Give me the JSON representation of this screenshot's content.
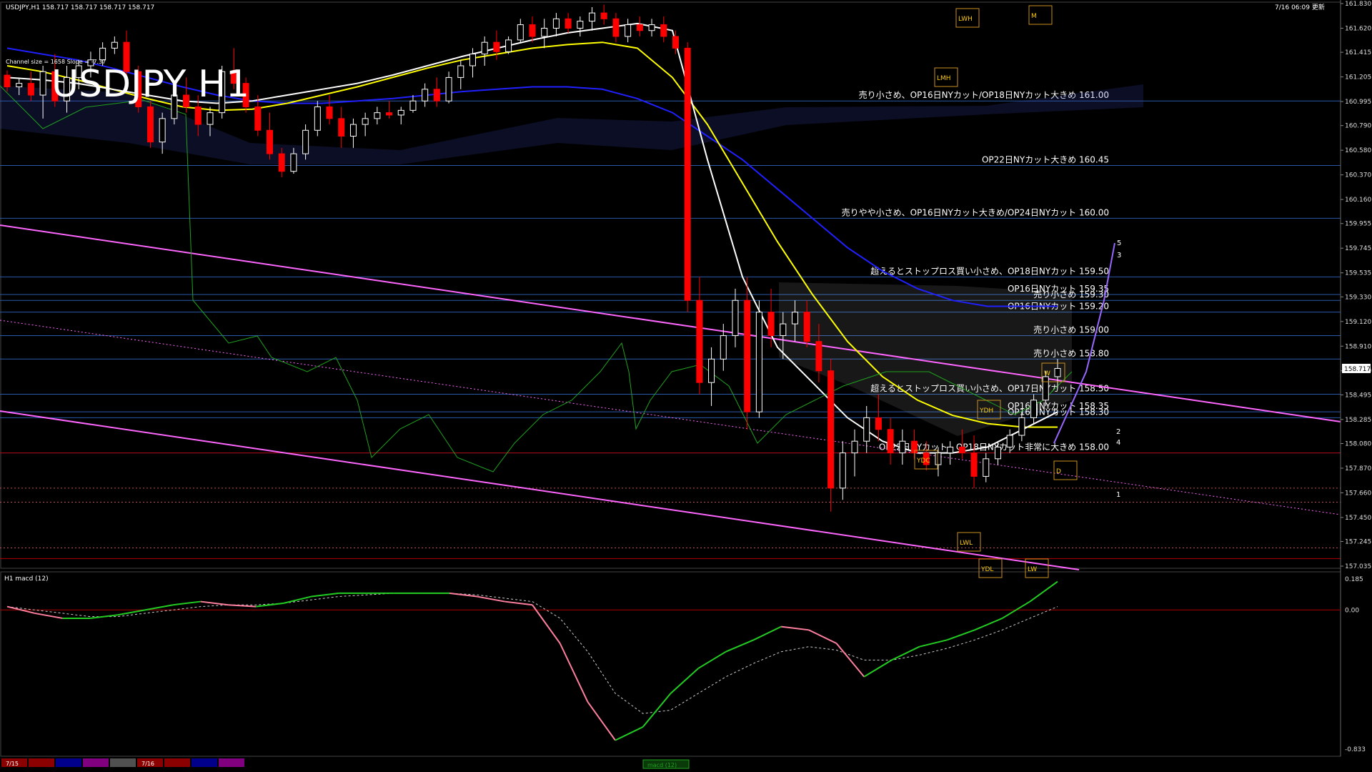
{
  "window": {
    "header": "USDJPY,H1  158.717 158.717 158.717 158.717",
    "timestamp": "7/16 06:09 更新",
    "big_title": "USDJPY H1",
    "channel_info": "Channel size = 1658 Slope = -7.37"
  },
  "colors": {
    "background": "#000000",
    "bull_candle": "#ffffff",
    "bear_candle": "#ff0000",
    "sma_fast": "#ffffff",
    "sma_mid": "#ffff00",
    "sma_slow": "#2020ff",
    "channel": "#ff66ff",
    "hline": "#2a5aa8",
    "macd_up": "#22cc22",
    "macd_down": "#ff7f9f",
    "signal": "#cccccc",
    "ichimoku_span": "#c8c8c8",
    "price_tag": "#ffffff"
  },
  "price_axis": {
    "min": 157.035,
    "max": 161.83,
    "ticks": [
      "161.830",
      "161.620",
      "161.415",
      "161.205",
      "160.995",
      "160.790",
      "160.580",
      "160.370",
      "160.160",
      "159.955",
      "159.745",
      "159.535",
      "159.330",
      "159.120",
      "158.910",
      "158.700",
      "158.495",
      "158.285",
      "158.080",
      "157.870",
      "157.660",
      "157.450",
      "157.245",
      "157.035"
    ],
    "current_price": "158.717"
  },
  "levels": [
    {
      "label": "売り小さめ、OP16日NYカット/OP18日NYカット大きめ 161.00",
      "price": 161.0
    },
    {
      "label": "OP22日NYカット大きめ 160.45",
      "price": 160.45
    },
    {
      "label": "売りやや小さめ、OP16日NYカット大きめ/OP24日NYカット 160.00",
      "price": 160.0
    },
    {
      "label": "超えるとストップロス買い小さめ、OP18日NYカット 159.50",
      "price": 159.5
    },
    {
      "label": "OP16日NYカット 159.35",
      "price": 159.35
    },
    {
      "label": "売り小さめ 159.30",
      "price": 159.3
    },
    {
      "label": "OP16日NYカット 159.20",
      "price": 159.2
    },
    {
      "label": "売り小さめ 159.00",
      "price": 159.0
    },
    {
      "label": "売り小さめ 158.80",
      "price": 158.8
    },
    {
      "label": "超えるとストップロス買い小さめ、OP17日NYカット 158.50",
      "price": 158.5
    },
    {
      "label": "OP16日NYカット 158.35",
      "price": 158.35
    },
    {
      "label": "OP16日NYカット 158.30",
      "price": 158.3
    },
    {
      "label": "OP22日NYカット、OP18日NYカット非常に大きめ 158.00",
      "price": 158.0
    }
  ],
  "tags": [
    "LWH",
    "M",
    "LMH",
    "YDH",
    "YDC",
    "YDL",
    "LWL",
    "LW",
    "W",
    "D"
  ],
  "wave_labels": [
    "5",
    "3",
    "2",
    "4",
    "1"
  ],
  "chart_data": {
    "type": "candlestick",
    "symbol": "USDJPY",
    "timeframe": "H1",
    "ylim": [
      157.035,
      161.83
    ],
    "candles": [
      [
        161.22,
        161.26,
        161.08,
        161.12
      ],
      [
        161.12,
        161.2,
        161.05,
        161.15
      ],
      [
        161.15,
        161.25,
        161.0,
        161.05
      ],
      [
        161.05,
        161.3,
        160.85,
        161.25
      ],
      [
        161.25,
        161.4,
        160.95,
        161.0
      ],
      [
        161.0,
        161.3,
        160.9,
        161.2
      ],
      [
        161.2,
        161.35,
        161.1,
        161.3
      ],
      [
        161.3,
        161.42,
        161.2,
        161.35
      ],
      [
        161.35,
        161.5,
        161.3,
        161.45
      ],
      [
        161.45,
        161.55,
        161.4,
        161.5
      ],
      [
        161.5,
        161.6,
        161.2,
        161.25
      ],
      [
        161.25,
        161.3,
        160.9,
        160.95
      ],
      [
        160.95,
        161.0,
        160.6,
        160.65
      ],
      [
        160.65,
        160.9,
        160.55,
        160.85
      ],
      [
        160.85,
        161.1,
        160.8,
        161.05
      ],
      [
        161.05,
        161.2,
        160.9,
        160.95
      ],
      [
        160.95,
        161.05,
        160.7,
        160.8
      ],
      [
        160.8,
        160.95,
        160.7,
        160.9
      ],
      [
        160.9,
        161.3,
        160.85,
        161.25
      ],
      [
        161.25,
        161.45,
        161.1,
        161.15
      ],
      [
        161.15,
        161.2,
        160.9,
        160.95
      ],
      [
        160.95,
        161.05,
        160.7,
        160.75
      ],
      [
        160.75,
        160.9,
        160.5,
        160.55
      ],
      [
        160.55,
        160.6,
        160.35,
        160.4
      ],
      [
        160.4,
        160.6,
        160.38,
        160.55
      ],
      [
        160.55,
        160.8,
        160.5,
        160.75
      ],
      [
        160.75,
        161.0,
        160.7,
        160.95
      ],
      [
        160.95,
        161.05,
        160.8,
        160.85
      ],
      [
        160.85,
        160.95,
        160.6,
        160.7
      ],
      [
        160.7,
        160.85,
        160.6,
        160.8
      ],
      [
        160.8,
        160.9,
        160.7,
        160.85
      ],
      [
        160.85,
        160.95,
        160.8,
        160.9
      ],
      [
        160.9,
        161.0,
        160.85,
        160.88
      ],
      [
        160.88,
        160.95,
        160.8,
        160.92
      ],
      [
        160.92,
        161.05,
        160.9,
        161.0
      ],
      [
        161.0,
        161.15,
        160.95,
        161.1
      ],
      [
        161.1,
        161.2,
        160.95,
        161.0
      ],
      [
        161.0,
        161.25,
        160.98,
        161.2
      ],
      [
        161.2,
        161.35,
        161.1,
        161.3
      ],
      [
        161.3,
        161.45,
        161.2,
        161.4
      ],
      [
        161.4,
        161.55,
        161.3,
        161.5
      ],
      [
        161.5,
        161.6,
        161.35,
        161.42
      ],
      [
        161.42,
        161.55,
        161.4,
        161.52
      ],
      [
        161.52,
        161.7,
        161.5,
        161.65
      ],
      [
        161.65,
        161.72,
        161.5,
        161.55
      ],
      [
        161.55,
        161.7,
        161.45,
        161.62
      ],
      [
        161.62,
        161.75,
        161.55,
        161.7
      ],
      [
        161.7,
        161.75,
        161.58,
        161.62
      ],
      [
        161.62,
        161.72,
        161.55,
        161.68
      ],
      [
        161.68,
        161.8,
        161.6,
        161.75
      ],
      [
        161.75,
        161.82,
        161.65,
        161.7
      ],
      [
        161.7,
        161.75,
        161.5,
        161.55
      ],
      [
        161.55,
        161.7,
        161.5,
        161.65
      ],
      [
        161.65,
        161.72,
        161.55,
        161.6
      ],
      [
        161.6,
        161.7,
        161.55,
        161.65
      ],
      [
        161.65,
        161.72,
        161.5,
        161.55
      ],
      [
        161.55,
        161.6,
        161.4,
        161.45
      ],
      [
        161.45,
        161.5,
        159.2,
        159.3
      ],
      [
        159.3,
        159.5,
        158.5,
        158.6
      ],
      [
        158.6,
        158.9,
        158.4,
        158.8
      ],
      [
        158.8,
        159.1,
        158.7,
        159.0
      ],
      [
        159.0,
        159.4,
        158.9,
        159.3
      ],
      [
        159.3,
        159.5,
        158.2,
        158.35
      ],
      [
        158.35,
        159.3,
        158.3,
        159.2
      ],
      [
        159.2,
        159.4,
        158.9,
        159.0
      ],
      [
        159.0,
        159.2,
        158.8,
        159.1
      ],
      [
        159.1,
        159.3,
        158.95,
        159.2
      ],
      [
        159.2,
        159.3,
        158.9,
        158.95
      ],
      [
        158.95,
        159.1,
        158.6,
        158.7
      ],
      [
        158.7,
        158.8,
        157.5,
        157.7
      ],
      [
        157.7,
        158.1,
        157.6,
        158.0
      ],
      [
        158.0,
        158.2,
        157.8,
        158.1
      ],
      [
        158.1,
        158.4,
        158.0,
        158.3
      ],
      [
        158.3,
        158.5,
        158.1,
        158.2
      ],
      [
        158.2,
        158.3,
        157.9,
        158.0
      ],
      [
        158.0,
        158.2,
        157.9,
        158.1
      ],
      [
        158.1,
        158.2,
        157.95,
        158.0
      ],
      [
        158.0,
        158.1,
        157.85,
        157.9
      ],
      [
        157.9,
        158.05,
        157.8,
        158.0
      ],
      [
        158.0,
        158.1,
        157.9,
        158.05
      ],
      [
        158.05,
        158.2,
        157.95,
        158.0
      ],
      [
        158.0,
        158.15,
        157.7,
        157.8
      ],
      [
        157.8,
        158.0,
        157.75,
        157.95
      ],
      [
        157.95,
        158.1,
        157.9,
        158.05
      ],
      [
        158.05,
        158.2,
        158.0,
        158.15
      ],
      [
        158.15,
        158.35,
        158.1,
        158.3
      ],
      [
        158.3,
        158.5,
        158.25,
        158.45
      ],
      [
        158.45,
        158.7,
        158.4,
        158.65
      ],
      [
        158.65,
        158.8,
        158.55,
        158.72
      ]
    ],
    "sma_fast": [
      161.2,
      161.18,
      161.15,
      161.1,
      161.05,
      161.0,
      160.98,
      161.0,
      161.05,
      161.1,
      161.15,
      161.22,
      161.3,
      161.38,
      161.45,
      161.52,
      161.58,
      161.62,
      161.66,
      161.6,
      160.5,
      159.5,
      158.9,
      158.6,
      158.3,
      158.1,
      158.0,
      158.0,
      158.05,
      158.2,
      158.35
    ],
    "sma_mid": [
      161.3,
      161.25,
      161.18,
      161.1,
      161.02,
      160.95,
      160.92,
      160.93,
      160.98,
      161.05,
      161.12,
      161.2,
      161.28,
      161.35,
      161.4,
      161.45,
      161.48,
      161.5,
      161.45,
      161.2,
      160.8,
      160.3,
      159.8,
      159.35,
      158.95,
      158.65,
      158.45,
      158.32,
      158.25,
      158.22,
      158.22
    ],
    "sma_slow": [
      161.45,
      161.4,
      161.35,
      161.28,
      161.2,
      161.12,
      161.05,
      161.0,
      160.98,
      160.98,
      161.0,
      161.02,
      161.05,
      161.08,
      161.1,
      161.12,
      161.12,
      161.1,
      161.02,
      160.9,
      160.7,
      160.5,
      160.25,
      160.0,
      159.75,
      159.55,
      159.4,
      159.3,
      159.25,
      159.25,
      159.25
    ],
    "macd_indicator": {
      "label": "H1 macd (12)",
      "min": -0.833,
      "max": 0.185,
      "ticks": [
        "0.185",
        "0.00",
        "-0.833"
      ],
      "macd": [
        0.02,
        -0.02,
        -0.05,
        -0.05,
        -0.03,
        0.0,
        0.03,
        0.05,
        0.03,
        0.02,
        0.04,
        0.08,
        0.1,
        0.1,
        0.1,
        0.1,
        0.1,
        0.08,
        0.05,
        0.03,
        -0.2,
        -0.55,
        -0.78,
        -0.7,
        -0.5,
        -0.35,
        -0.25,
        -0.18,
        -0.1,
        -0.12,
        -0.2,
        -0.4,
        -0.3,
        -0.22,
        -0.18,
        -0.12,
        -0.05,
        0.05,
        0.17
      ],
      "signal": [
        0.02,
        0.0,
        -0.02,
        -0.04,
        -0.04,
        -0.02,
        0.0,
        0.02,
        0.03,
        0.03,
        0.04,
        0.06,
        0.08,
        0.09,
        0.1,
        0.1,
        0.1,
        0.09,
        0.07,
        0.05,
        -0.05,
        -0.25,
        -0.5,
        -0.62,
        -0.6,
        -0.5,
        -0.4,
        -0.32,
        -0.25,
        -0.22,
        -0.24,
        -0.3,
        -0.3,
        -0.27,
        -0.23,
        -0.18,
        -0.12,
        -0.05,
        0.02
      ]
    },
    "time_labels": [
      "7/15",
      "7/16"
    ],
    "bottom_label": "macd (12)"
  }
}
